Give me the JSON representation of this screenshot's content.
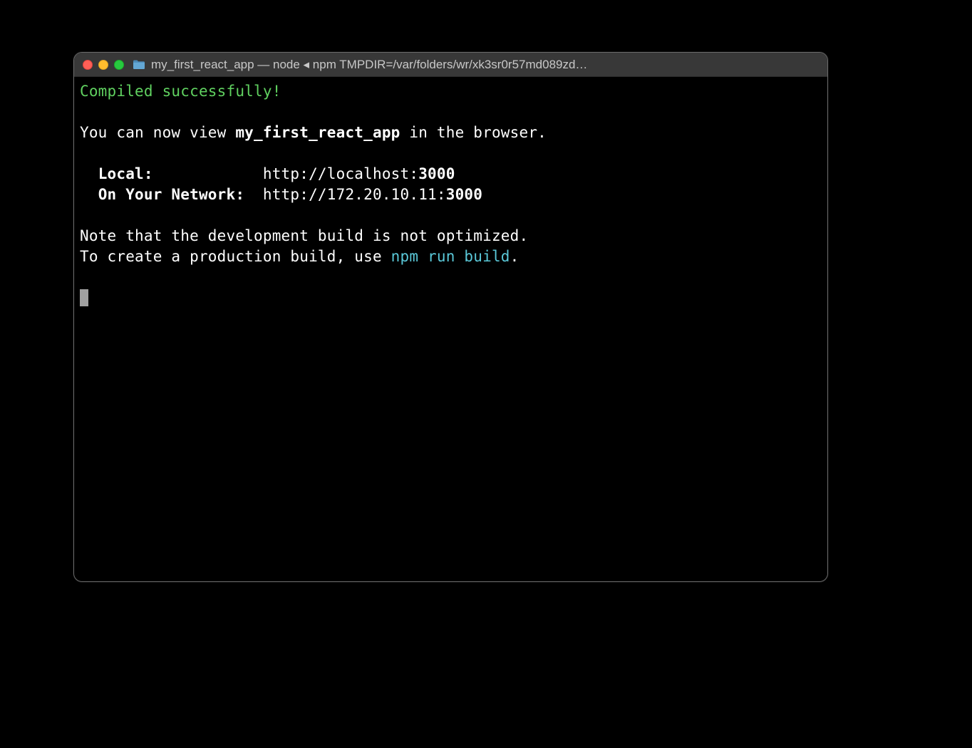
{
  "window": {
    "title": "my_first_react_app — node ◂ npm TMPDIR=/var/folders/wr/xk3sr0r57md089zd…"
  },
  "terminal": {
    "status_line": "Compiled successfully!",
    "view_prefix": "You can now view ",
    "app_name": "my_first_react_app",
    "view_suffix": " in the browser.",
    "local_label": "Local:",
    "local_url_prefix": "http://localhost:",
    "local_port": "3000",
    "network_label": "On Your Network:",
    "network_url_prefix": "http://172.20.10.11:",
    "network_port": "3000",
    "note_line1": "Note that the development build is not optimized.",
    "note_line2_prefix": "To create a production build, use ",
    "note_line2_cmd": "npm run build",
    "note_line2_suffix": "."
  }
}
